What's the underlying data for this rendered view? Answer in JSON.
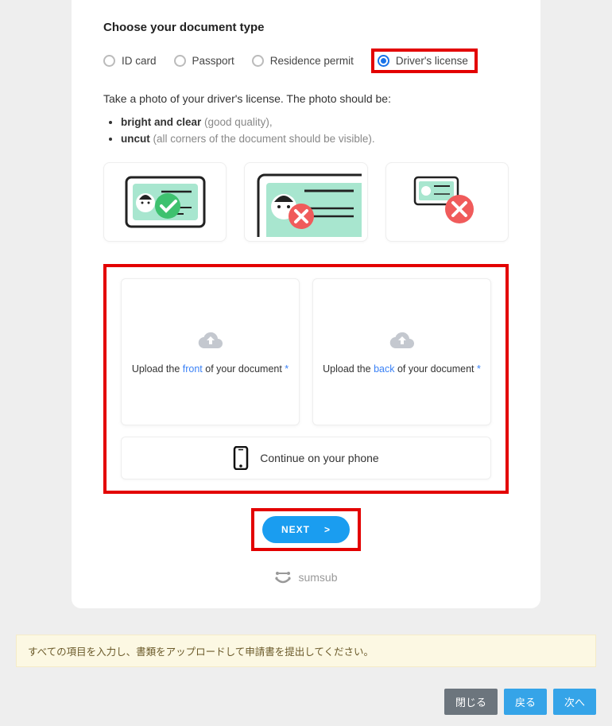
{
  "sectionTitle": "Choose your document type",
  "docTypes": {
    "idCard": "ID card",
    "passport": "Passport",
    "residence": "Residence permit",
    "driver": "Driver's license"
  },
  "instruction": "Take a photo of your driver's license. The photo should be:",
  "bullets": {
    "b1_bold": "bright and clear",
    "b1_rest": " (good quality),",
    "b2_bold": "uncut",
    "b2_rest": " (all corners of the document should be visible)."
  },
  "upload": {
    "front_pre": "Upload the ",
    "front_accent": "front",
    "front_post": " of your document ",
    "back_pre": "Upload the ",
    "back_accent": "back",
    "back_post": " of your document ",
    "star": "*"
  },
  "continuePhone": "Continue on your phone",
  "nextLabel": "NEXT",
  "nextArrow": ">",
  "brand": "sumsub",
  "warning": "すべての項目を入力し、書類をアップロードして申請書を提出してください。",
  "footer": {
    "close": "閉じる",
    "back": "戻る",
    "next": "次へ"
  }
}
